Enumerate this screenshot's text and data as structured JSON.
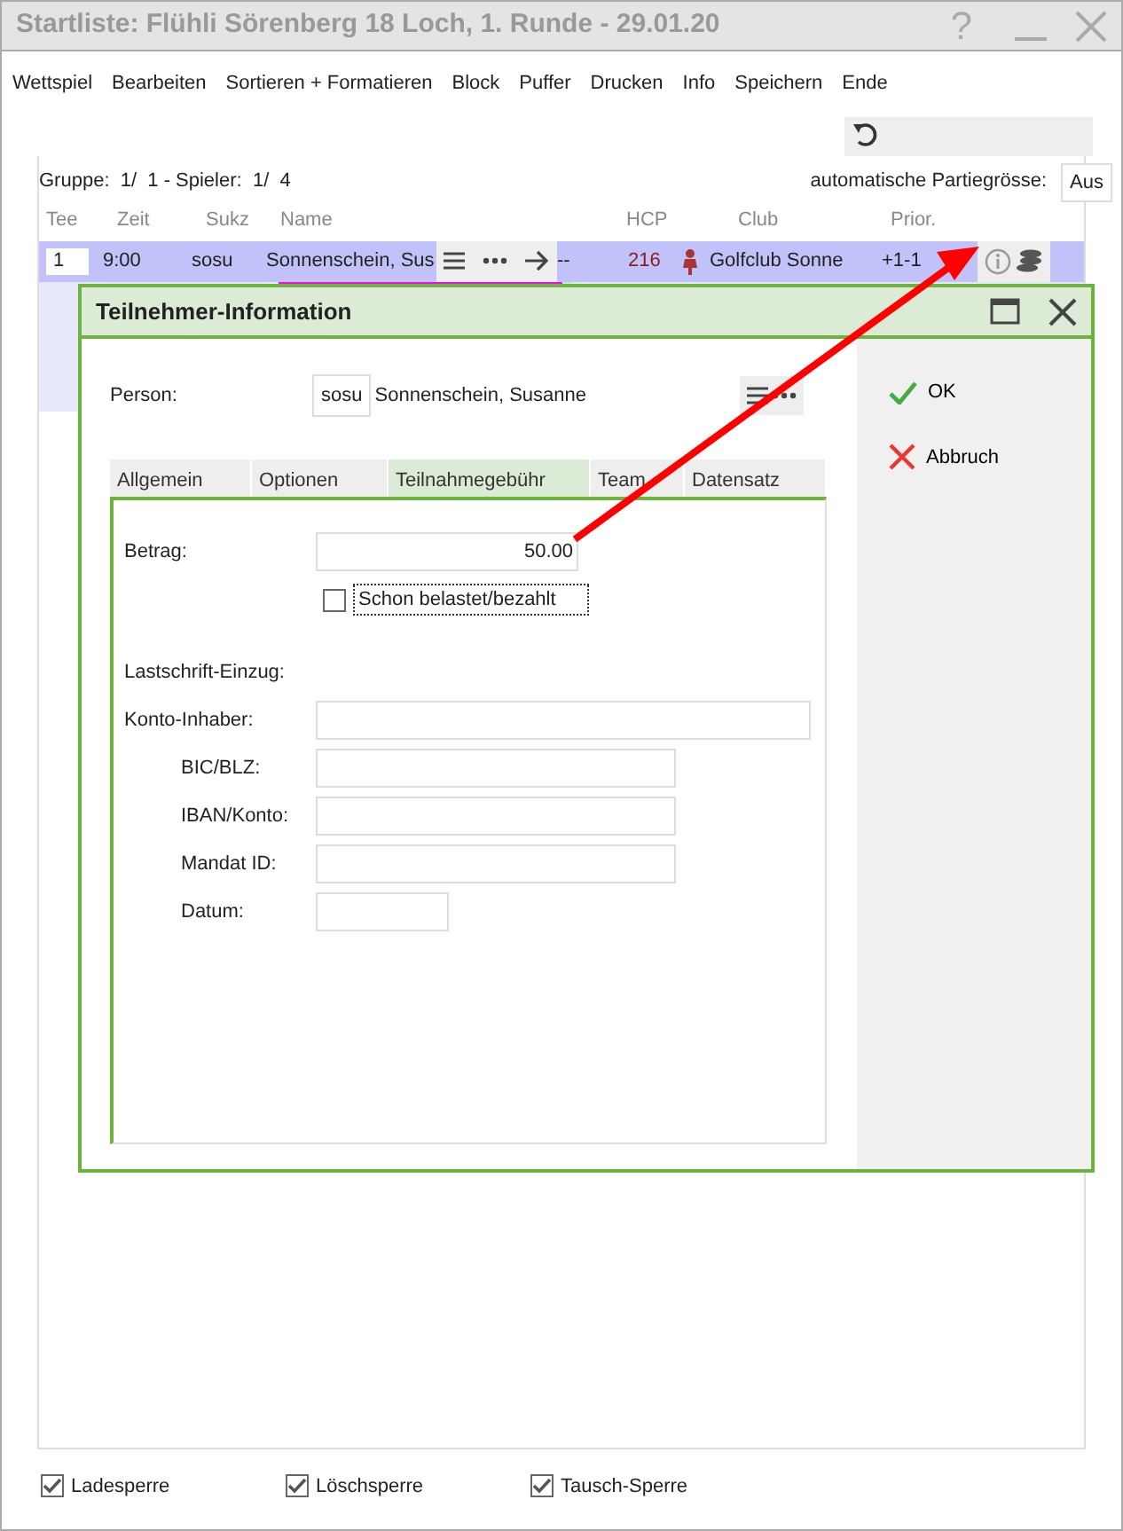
{
  "window": {
    "title": "Startliste: Flühli Sörenberg 18 Loch, 1. Runde - 29.01.20",
    "help": "?"
  },
  "menu": [
    "Wettspiel",
    "Bearbeiten",
    "Sortieren + Formatieren",
    "Block",
    "Puffer",
    "Drucken",
    "Info",
    "Speichern",
    "Ende"
  ],
  "group_info": "Gruppe:  1/  1 - Spieler:  1/  4",
  "party_size": {
    "label": "automatische Partiegrösse:",
    "value": "Aus"
  },
  "table": {
    "columns": [
      "Tee",
      "Zeit",
      "Sukz",
      "Name",
      "HCP",
      "Club",
      "Prior."
    ],
    "rows": [
      {
        "tee": "1",
        "time": "9:00",
        "code": "sosu",
        "name": "Sonnenschein, Sus",
        "dashes": "--",
        "hcp": "216",
        "club": "Golfclub Sonne",
        "priority": "+1-1",
        "selected": true
      }
    ]
  },
  "dialog": {
    "title": "Teilnehmer-Information",
    "person": {
      "label": "Person:",
      "code": "sosu",
      "name": "Sonnenschein, Susanne"
    },
    "tabs": [
      {
        "label": "Allgemein",
        "selected": false
      },
      {
        "label": "Optionen",
        "selected": false
      },
      {
        "label": "Teilnahmegebühr",
        "selected": true
      },
      {
        "label": "Team",
        "selected": false
      },
      {
        "label": "Datensatz",
        "selected": false
      }
    ],
    "fields": [
      {
        "kind": "amount",
        "label": "Betrag:",
        "value": "50.00"
      },
      {
        "kind": "checkbox",
        "label": "Schon belastet/bezahlt",
        "checked": false
      },
      {
        "kind": "heading",
        "label": "Lastschrift-Einzug:"
      },
      {
        "kind": "field",
        "label": "Konto-Inhaber:"
      },
      {
        "kind": "subfield",
        "label": "BIC/BLZ:"
      },
      {
        "kind": "subfield",
        "label": "IBAN/Konto:"
      },
      {
        "kind": "subfield",
        "label": "Mandat ID:"
      },
      {
        "kind": "date",
        "label": "Datum:"
      }
    ],
    "buttons": [
      {
        "kind": "ok",
        "label": "OK"
      },
      {
        "kind": "cancel",
        "label": "Abbruch"
      }
    ]
  },
  "footer": [
    {
      "label": "Ladesperre",
      "checked": true
    },
    {
      "label": "Löschsperre",
      "checked": true
    },
    {
      "label": "Tausch-Sperre",
      "checked": true
    }
  ]
}
